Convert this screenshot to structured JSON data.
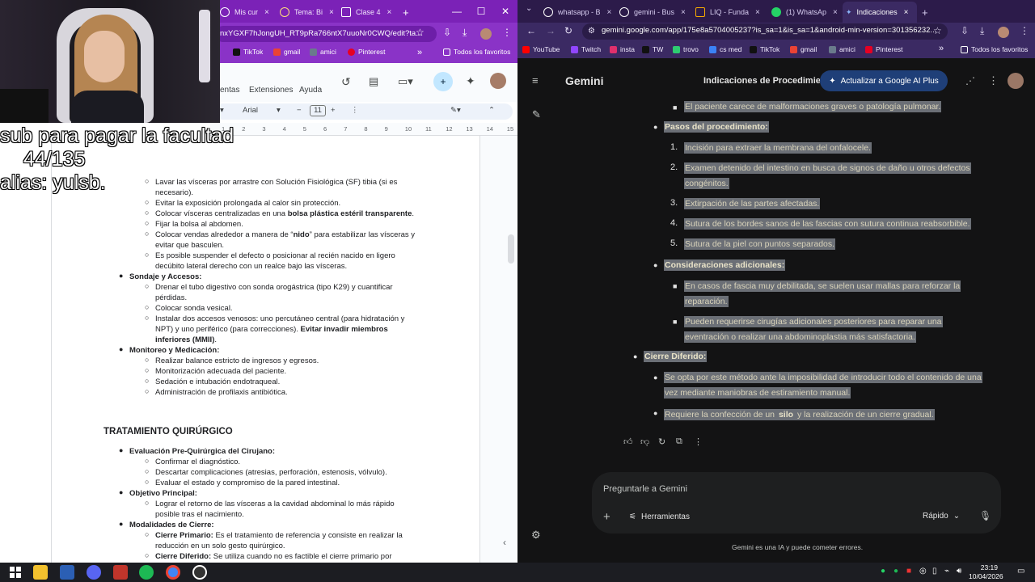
{
  "overlay": {
    "line1": "sub para pagar la facultad",
    "line2": "44/135",
    "line3": "alias: yulsb."
  },
  "left_browser": {
    "tabs": [
      {
        "label": "Mis cur",
        "close": "×"
      },
      {
        "label": "Tema: Bi",
        "close": "×"
      },
      {
        "label": "Clase 4 ",
        "close": "×"
      }
    ],
    "new_tab": "+",
    "window_controls": [
      "—",
      "☐",
      "✕"
    ],
    "url": "nxYGXF7hJongUH_RT9pRa766ntX7uuoNr0CWQ/edit?ta...",
    "bookmarks": [
      "TikTok",
      "gmail",
      "amici",
      "Pinterest"
    ],
    "bookmarks_more": "»",
    "bookmarks_folder": "Todos los favoritos"
  },
  "docs": {
    "menu": [
      "entas",
      "Extensiones",
      "Ayuda"
    ],
    "font": "Arial",
    "font_size": "11",
    "ruler": [
      "1",
      "2",
      "3",
      "4",
      "5",
      "6",
      "7",
      "8",
      "9",
      "10",
      "11",
      "12",
      "13",
      "14",
      "15",
      "16",
      "17",
      "18"
    ],
    "lines": [
      {
        "indent": 2,
        "text": "Lavar las vísceras por arrastre con Solución Fisiológica (SF) tibia (si es"
      },
      {
        "indent": 2,
        "cont": true,
        "text": "necesario)."
      },
      {
        "indent": 2,
        "text": "Evitar la exposición prolongada al calor sin protección."
      },
      {
        "indent": 2,
        "text": "Colocar vísceras centralizadas en una ",
        "bold": "bolsa plástica estéril transparente",
        "after": "."
      },
      {
        "indent": 2,
        "text": "Fijar la bolsa al abdomen."
      },
      {
        "indent": 2,
        "text": "Colocar vendas alrededor a manera de “",
        "bold": "nido",
        "after": "” para estabilizar las vísceras y"
      },
      {
        "indent": 2,
        "cont": true,
        "text": "evitar que basculen."
      },
      {
        "indent": 2,
        "text": "Es posible suspender el defecto o posicionar al recién nacido en ligero"
      },
      {
        "indent": 2,
        "cont": true,
        "text": "decúbito lateral derecho con un realce bajo las vísceras."
      },
      {
        "indent": 1,
        "bold": "Sondaje y Accesos:"
      },
      {
        "indent": 2,
        "text": "Drenar el tubo digestivo con sonda orogástrica (tipo K29) y cuantificar"
      },
      {
        "indent": 2,
        "cont": true,
        "text": "pérdidas."
      },
      {
        "indent": 2,
        "text": "Colocar sonda vesical."
      },
      {
        "indent": 2,
        "text": "Instalar dos accesos venosos: uno percutáneo central (para hidratación y"
      },
      {
        "indent": 2,
        "cont": true,
        "text": "NPT) y uno periférico (para correcciones). ",
        "bold": "Evitar invadir miembros"
      },
      {
        "indent": 2,
        "cont": true,
        "bold": "inferiores (MMII)",
        "after": "."
      },
      {
        "indent": 1,
        "bold": "Monitoreo y Medicación:"
      },
      {
        "indent": 2,
        "text": "Realizar balance estricto de ingresos y egresos."
      },
      {
        "indent": 2,
        "text": "Monitorización adecuada del paciente."
      },
      {
        "indent": 2,
        "text": "Sedación e intubación endotraqueal."
      },
      {
        "indent": 2,
        "text": "Administración de profilaxis antibiótica."
      }
    ],
    "heading": "TRATAMIENTO QUIRÚRGICO",
    "lines2": [
      {
        "indent": 1,
        "bold": "Evaluación Pre-Quirúrgica del Cirujano:"
      },
      {
        "indent": 2,
        "text": "Confirmar el diagnóstico."
      },
      {
        "indent": 2,
        "text": "Descartar complicaciones (atresias, perforación, estenosis, vólvulo)."
      },
      {
        "indent": 2,
        "text": "Evaluar el estado y compromiso de la pared intestinal."
      },
      {
        "indent": 1,
        "bold": "Objetivo Principal:"
      },
      {
        "indent": 2,
        "text": "Lograr el retorno de las vísceras a la cavidad abdominal lo más rápido"
      },
      {
        "indent": 2,
        "cont": true,
        "text": "posible tras el nacimiento."
      },
      {
        "indent": 1,
        "bold": "Modalidades de Cierre:"
      },
      {
        "indent": 2,
        "bold": "Cierre Primario:",
        "after": " Es el tratamiento de referencia y consiste en realizar la"
      },
      {
        "indent": 2,
        "cont": true,
        "text": "reducción en un solo gesto quirúrgico."
      },
      {
        "indent": 2,
        "bold": "Cierre Diferido:",
        "after": " Se utiliza cuando no es factible el cierre primario por"
      }
    ]
  },
  "right_browser": {
    "tabs": [
      {
        "label": "whatsapp - B",
        "close": "×"
      },
      {
        "label": "gemini - Bus",
        "close": "×"
      },
      {
        "label": "LIQ - Funda",
        "close": "×"
      },
      {
        "label": "(1) WhatsAp",
        "close": "×"
      },
      {
        "label": "Indicaciones",
        "close": "×"
      }
    ],
    "new_tab": "+",
    "url": "gemini.google.com/app/175e8a5704005237?is_sa=1&is_sa=1&android-min-version=301356232...",
    "bookmarks": [
      "YouTube",
      "Twitch",
      "insta",
      "TW",
      "trovo",
      "cs med",
      "TikTok",
      "gmail",
      "amici",
      "Pinterest"
    ],
    "bookmarks_more": "»",
    "bookmarks_folder": "Todos los favoritos"
  },
  "gemini": {
    "app_title": "Gemini",
    "conversation_title": "Indicaciones de Procedimien",
    "upgrade_label": "Actualizar a Google AI Plus",
    "response": {
      "first_line": "El paciente carece de malformaciones graves o patología pulmonar.",
      "steps_heading": "Pasos del procedimiento:",
      "steps": [
        {
          "num": "1.",
          "lines": [
            "Incisión para extraer la membrana del onfalocele."
          ]
        },
        {
          "num": "2.",
          "lines": [
            "Examen detenido del intestino en busca de signos de daño u otros defectos",
            "congénitos."
          ]
        },
        {
          "num": "3.",
          "lines": [
            "Extirpación de las partes afectadas."
          ]
        },
        {
          "num": "4.",
          "lines": [
            "Sutura de los bordes sanos de las fascias con sutura continua reabsorbible."
          ]
        },
        {
          "num": "5.",
          "lines": [
            "Sutura de la piel con puntos separados."
          ]
        }
      ],
      "considerations_heading": "Consideraciones adicionales:",
      "considerations": [
        {
          "lines": [
            "En casos de fascia muy debilitada, se suelen usar mallas para reforzar la",
            "reparación."
          ]
        },
        {
          "lines": [
            "Pueden requerirse cirugías adicionales posteriores para reparar una",
            "eventración o realizar una abdominoplastia más satisfactoria."
          ]
        }
      ],
      "deferred_heading": "Cierre Diferido:",
      "deferred": [
        {
          "lines": [
            "Se opta por este método ante la imposibilidad de introducir todo el contenido de una",
            "vez mediante maniobras de estiramiento manual."
          ]
        },
        {
          "pre": "Requiere la confección de un ",
          "bold": "silo",
          "post": " y la realización de un cierre gradual."
        }
      ]
    },
    "input_placeholder": "Preguntarle a Gemini",
    "tools_label": "Herramientas",
    "mode_label": "Rápido",
    "disclaimer": "Gemini es una IA y puede cometer errores."
  },
  "taskbar": {
    "time": "23:19",
    "date": "10/04/2026"
  }
}
